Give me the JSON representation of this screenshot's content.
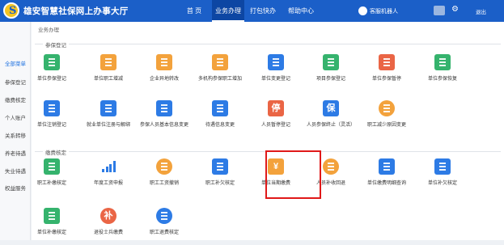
{
  "header": {
    "title": "雄安智慧社保网上办事大厅",
    "logo_letter": "S",
    "nav": [
      "首 页",
      "业务办理",
      "打包快办",
      "帮助中心"
    ],
    "robot": "客服机器人",
    "logout": "退出",
    "settings_icon": "gear-icon",
    "brand_color": "#1b5fc8"
  },
  "sidebar": {
    "items": [
      "全部菜单",
      "参保登记",
      "缴费核定",
      "个人账户",
      "关系转移",
      "养老待遇",
      "失业待遇",
      "权益服务"
    ]
  },
  "breadcrumb": "业务办理",
  "sections": [
    {
      "title": "参保登记",
      "tiles": [
        {
          "label": "单位参保登记",
          "icon": "register-doc-icon",
          "color": "#35b36d"
        },
        {
          "label": "单位职工增减",
          "icon": "staff-change-icon",
          "color": "#f3a23c"
        },
        {
          "label": "企业异地转改",
          "icon": "transfer-doc-icon",
          "color": "#f3a23c"
        },
        {
          "label": "多机构参保职工增加",
          "icon": "multi-org-icon",
          "color": "#f3a23c"
        },
        {
          "label": "单位变更登记",
          "icon": "company-change-icon",
          "color": "#2d7be5"
        },
        {
          "label": "项目参保登记",
          "icon": "project-edit-icon",
          "color": "#35b36d"
        },
        {
          "label": "单位参保暂停",
          "icon": "pause-icon",
          "color": "#ea6545"
        },
        {
          "label": "单位参保恢复",
          "icon": "resume-icon",
          "color": "#35b36d"
        },
        {
          "label": "单位注销登记",
          "icon": "cancel-register-icon",
          "color": "#2d7be5"
        },
        {
          "label": "就业单位注册与解绑",
          "icon": "employer-bind-icon",
          "color": "#2d7be5"
        },
        {
          "label": "参保人员基本信息变更",
          "icon": "person-edit-icon",
          "color": "#2d7be5"
        },
        {
          "label": "待遇信息变更",
          "icon": "benefit-change-icon",
          "color": "#2d7be5"
        },
        {
          "label": "人员暂停登记",
          "icon": "person-pause-icon",
          "color": "#ea6545",
          "glyph": "停"
        },
        {
          "label": "人员参保终止（灵活）",
          "icon": "person-stop-icon",
          "color": "#2d7be5",
          "glyph": "保"
        },
        {
          "label": "职工减少原因变更",
          "icon": "reduce-reason-icon",
          "color": "#f3a23c"
        }
      ]
    },
    {
      "title": "缴费核定",
      "tiles": [
        {
          "label": "职工补缴核定",
          "icon": "back-pay-icon",
          "color": "#35b36d"
        },
        {
          "label": "年度工资申报",
          "icon": "bar-chart-icon",
          "color": "#2d7be5"
        },
        {
          "label": "职工工资撤销",
          "icon": "undo-icon",
          "color": "#f3a23c"
        },
        {
          "label": "职工补欠核定",
          "icon": "arrears-icon",
          "color": "#2d7be5"
        },
        {
          "label": "单位当期缴费",
          "icon": "payment-yen-icon",
          "color": "#f3a23c",
          "glyph": "¥"
        },
        {
          "label": "人员补收回退",
          "icon": "refund-icon",
          "color": "#f3a23c"
        },
        {
          "label": "单位缴费明细查询",
          "icon": "payment-detail-icon",
          "color": "#2d7be5"
        },
        {
          "label": "单位补欠核定",
          "icon": "unit-arrears-icon",
          "color": "#2d7be5"
        },
        {
          "label": "单位补缴核定",
          "icon": "calc-icon",
          "color": "#35b36d"
        },
        {
          "label": "退役士兵缴费",
          "icon": "soldier-pay-icon",
          "color": "#ea6545",
          "glyph": "补"
        },
        {
          "label": "职工退费核定",
          "icon": "staff-refund-icon",
          "color": "#2d7be5"
        }
      ]
    }
  ]
}
